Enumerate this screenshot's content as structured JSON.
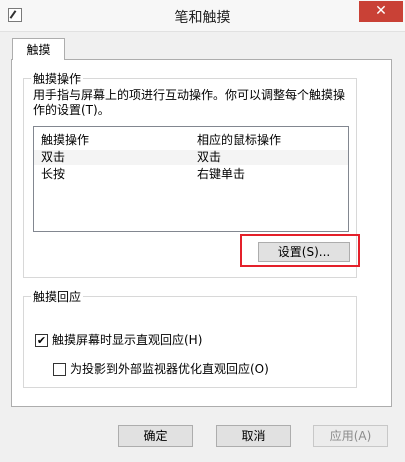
{
  "window": {
    "title": "笔和触摸",
    "close_glyph": "✕"
  },
  "tabs": [
    {
      "label": "触摸"
    }
  ],
  "touch_actions": {
    "group_title": "触摸操作",
    "description_line1": "用手指与屏幕上的项进行互动操作。你可以调整每个触摸操",
    "description_line2": "作的设置(T)。",
    "columns": [
      "触摸操作",
      "相应的鼠标操作"
    ],
    "rows": [
      {
        "action": "双击",
        "mouse": "双击",
        "selected": true
      },
      {
        "action": "长按",
        "mouse": "右键单击",
        "selected": false
      }
    ],
    "settings_button": "设置(S)..."
  },
  "touch_feedback": {
    "group_title": "触摸回应",
    "show_visual_feedback": {
      "label": "触摸屏幕时显示直观回应(H)",
      "checked": true
    },
    "optimize_projection": {
      "label": "为投影到外部监视器优化直观回应(O)",
      "checked": false
    }
  },
  "footer": {
    "ok": "确定",
    "cancel": "取消",
    "apply": "应用(A)"
  },
  "colors": {
    "highlight": "#e4202a",
    "close_button": "#c94136"
  }
}
